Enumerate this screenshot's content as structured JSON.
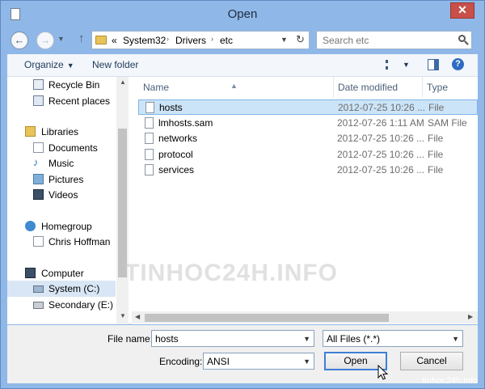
{
  "window": {
    "title": "Open"
  },
  "nav": {
    "breadcrumb_prefix": "«",
    "crumbs": [
      "System32",
      "Drivers",
      "etc"
    ],
    "search_placeholder": "Search etc"
  },
  "toolbar": {
    "organize_label": "Organize",
    "new_folder_label": "New folder"
  },
  "sidebar": {
    "items": [
      {
        "label": "Recycle Bin",
        "icon": "recycle-bin-icon"
      },
      {
        "label": "Recent places",
        "icon": "recent-places-icon"
      },
      {
        "label": "Libraries",
        "icon": "libraries-icon"
      },
      {
        "label": "Documents",
        "icon": "documents-icon"
      },
      {
        "label": "Music",
        "icon": "music-icon"
      },
      {
        "label": "Pictures",
        "icon": "pictures-icon"
      },
      {
        "label": "Videos",
        "icon": "videos-icon"
      },
      {
        "label": "Homegroup",
        "icon": "homegroup-icon"
      },
      {
        "label": "Chris Hoffman",
        "icon": "user-icon"
      },
      {
        "label": "Computer",
        "icon": "computer-icon"
      },
      {
        "label": "System (C:)",
        "icon": "drive-icon"
      },
      {
        "label": "Secondary (E:)",
        "icon": "drive-icon"
      }
    ]
  },
  "filelist": {
    "columns": [
      "Name",
      "Date modified",
      "Type"
    ],
    "rows": [
      {
        "name": "hosts",
        "date": "2012-07-25 10:26 ...",
        "type": "File"
      },
      {
        "name": "lmhosts.sam",
        "date": "2012-07-26 1:11 AM",
        "type": "SAM File"
      },
      {
        "name": "networks",
        "date": "2012-07-25 10:26 ...",
        "type": "File"
      },
      {
        "name": "protocol",
        "date": "2012-07-25 10:26 ...",
        "type": "File"
      },
      {
        "name": "services",
        "date": "2012-07-25 10:26 ...",
        "type": "File"
      }
    ]
  },
  "bottom": {
    "file_name_label": "File name:",
    "file_name_value": "hosts",
    "file_type_value": "All Files  (*.*)",
    "encoding_label": "Encoding:",
    "encoding_value": "ANSI",
    "open_label": "Open",
    "cancel_label": "Cancel"
  },
  "watermark": {
    "center": "TINHOC24H.INFO",
    "footer": "tinhoc24h.info"
  },
  "colors": {
    "title_bar": "#8fb8e8",
    "selection": "#cce4f7",
    "close_button": "#c7504b"
  }
}
